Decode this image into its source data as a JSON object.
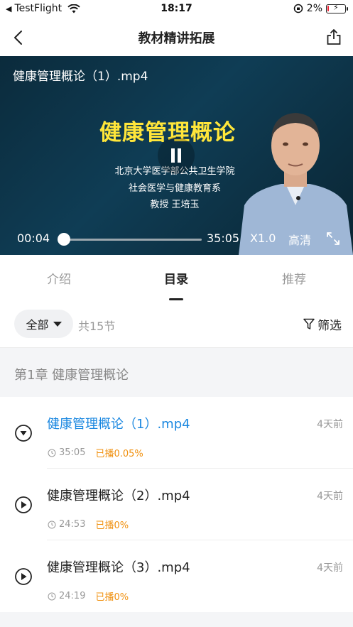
{
  "status_bar": {
    "carrier": "TestFlight",
    "time": "18:17",
    "battery_percent": "2%"
  },
  "nav": {
    "title": "教材精讲拓展"
  },
  "video": {
    "file_name": "健康管理概论（1）.mp4",
    "slide_title": "健康管理概论",
    "slide_lines": [
      "北京大学医学部公共卫生学院",
      "社会医学与健康教育系",
      "教授 王培玉"
    ],
    "current_time": "00:04",
    "duration": "35:05",
    "progress_fraction": 0.002,
    "speed": "X1.0",
    "quality": "高清"
  },
  "tabs": {
    "intro": "介绍",
    "toc": "目录",
    "recommend": "推荐"
  },
  "filter": {
    "chip_label": "全部",
    "count": "共15节",
    "filter_label": "筛选"
  },
  "chapter": {
    "title": "第1章  健康管理概论"
  },
  "lessons": [
    {
      "title": "健康管理概论（1）.mp4",
      "date": "4天前",
      "duration": "35:05",
      "progress": "已播0.05%"
    },
    {
      "title": "健康管理概论（2）.mp4",
      "date": "4天前",
      "duration": "24:53",
      "progress": "已播0%"
    },
    {
      "title": "健康管理概论（3）.mp4",
      "date": "4天前",
      "duration": "24:19",
      "progress": "已播0%"
    }
  ],
  "colors": {
    "accent": "#1a87e0",
    "progress_orange": "#f0900e",
    "video_title_yellow": "#ffe63a"
  }
}
